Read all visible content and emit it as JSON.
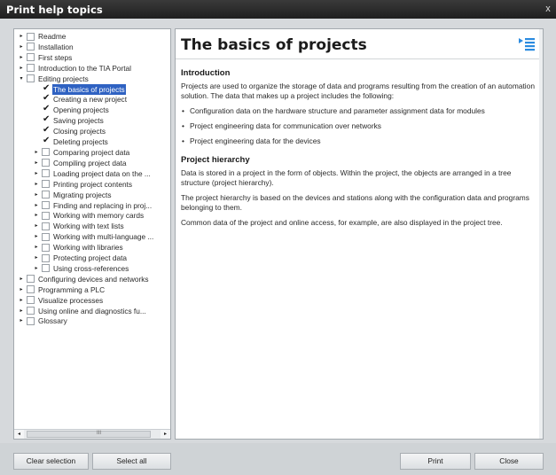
{
  "window": {
    "title": "Print help topics",
    "close_glyph": "x"
  },
  "tree": {
    "items": [
      {
        "label": "Readme",
        "arrow": "▸",
        "check": "",
        "depth": 0
      },
      {
        "label": "Installation",
        "arrow": "▸",
        "check": "",
        "depth": 0
      },
      {
        "label": "First steps",
        "arrow": "▸",
        "check": "",
        "depth": 0
      },
      {
        "label": "Introduction to the TIA Portal",
        "arrow": "▸",
        "check": "",
        "depth": 0
      },
      {
        "label": "Editing projects",
        "arrow": "▾",
        "check": "",
        "depth": 0
      },
      {
        "label": "The basics of projects",
        "arrow": "",
        "check": "✔",
        "depth": 1,
        "selected": true
      },
      {
        "label": "Creating a new project",
        "arrow": "",
        "check": "✔",
        "depth": 1
      },
      {
        "label": "Opening projects",
        "arrow": "",
        "check": "✔",
        "depth": 1
      },
      {
        "label": "Saving projects",
        "arrow": "",
        "check": "✔",
        "depth": 1
      },
      {
        "label": "Closing projects",
        "arrow": "",
        "check": "✔",
        "depth": 1
      },
      {
        "label": "Deleting projects",
        "arrow": "",
        "check": "✔",
        "depth": 1
      },
      {
        "label": "Comparing project data",
        "arrow": "▸",
        "check": "",
        "depth": 1
      },
      {
        "label": "Compiling project data",
        "arrow": "▸",
        "check": "",
        "depth": 1
      },
      {
        "label": "Loading project data on the ...",
        "arrow": "▸",
        "check": "",
        "depth": 1
      },
      {
        "label": "Printing project contents",
        "arrow": "▸",
        "check": "",
        "depth": 1
      },
      {
        "label": "Migrating projects",
        "arrow": "▸",
        "check": "",
        "depth": 1
      },
      {
        "label": "Finding and replacing in proj...",
        "arrow": "▸",
        "check": "",
        "depth": 1
      },
      {
        "label": "Working with memory cards",
        "arrow": "▸",
        "check": "",
        "depth": 1
      },
      {
        "label": "Working with text lists",
        "arrow": "▸",
        "check": "",
        "depth": 1
      },
      {
        "label": "Working with multi-language ...",
        "arrow": "▸",
        "check": "",
        "depth": 1
      },
      {
        "label": "Working with libraries",
        "arrow": "▸",
        "check": "",
        "depth": 1
      },
      {
        "label": "Protecting project data",
        "arrow": "▸",
        "check": "",
        "depth": 1
      },
      {
        "label": "Using cross-references",
        "arrow": "▸",
        "check": "",
        "depth": 1
      },
      {
        "label": "Configuring devices and networks",
        "arrow": "▸",
        "check": "",
        "depth": 0
      },
      {
        "label": "Programming a PLC",
        "arrow": "▸",
        "check": "",
        "depth": 0
      },
      {
        "label": "Visualize processes",
        "arrow": "▸",
        "check": "",
        "depth": 0
      },
      {
        "label": "Using online and diagnostics fu...",
        "arrow": "▸",
        "check": "",
        "depth": 0
      },
      {
        "label": "Glossary",
        "arrow": "▸",
        "check": "",
        "depth": 0
      }
    ],
    "scroll": {
      "left": "◂",
      "right": "▸",
      "grip": "III"
    }
  },
  "content": {
    "title": "The basics of projects",
    "sections": [
      {
        "heading": "Introduction",
        "paragraphs": [
          "Projects are used to organize the storage of data and programs resulting from the creation of an automation solution. The data that makes up a project includes the following:"
        ],
        "bullets": [
          "Configuration data on the hardware structure and parameter assignment data for modules",
          "Project engineering data for communication over networks",
          "Project engineering data for the devices"
        ]
      },
      {
        "heading": "Project hierarchy",
        "paragraphs": [
          "Data is stored in a project in the form of objects. Within the project, the objects are arranged in a tree structure (project hierarchy).",
          "The project hierarchy is based on the devices and stations along with the configuration data and programs belonging to them.",
          "Common data of the project and online access, for example, are also displayed in the project tree."
        ]
      }
    ]
  },
  "buttons": {
    "clear_selection": "Clear selection",
    "select_all": "Select all",
    "print": "Print",
    "close": "Close"
  },
  "colors": {
    "selection": "#2f62c2",
    "titlebar": "#2a2a2a",
    "toc_icon": "#2b8be0"
  }
}
